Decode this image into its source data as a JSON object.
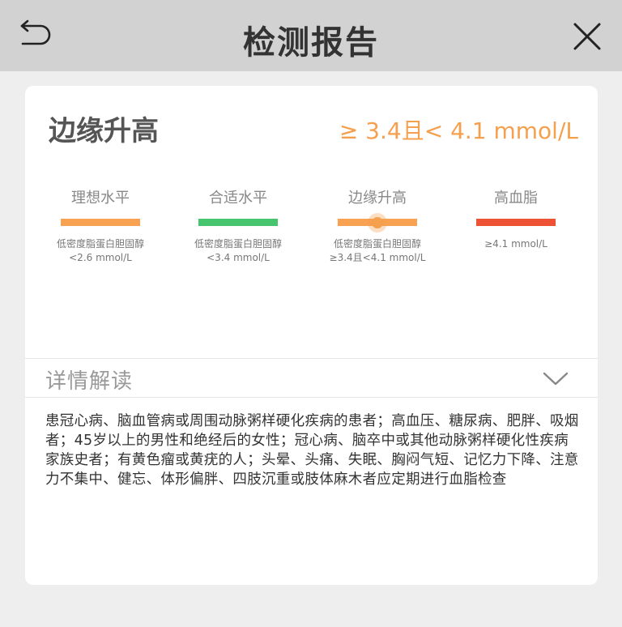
{
  "header": {
    "title": "检测报告",
    "back_icon": "back-arrow-icon",
    "close_icon": "close-icon"
  },
  "result": {
    "level": "边缘升高",
    "range": "≥ 3.4且< 4.1 mmol/L",
    "color": "#f5a04f"
  },
  "scale": [
    {
      "label": "理想水平",
      "color": "#f8a150",
      "desc1": "低密度脂蛋白胆固醇",
      "desc2": "<2.6 mmol/L",
      "current": false
    },
    {
      "label": "合适水平",
      "color": "#46c46e",
      "desc1": "低密度脂蛋白胆固醇",
      "desc2": "<3.4 mmol/L",
      "current": false
    },
    {
      "label": "边缘升高",
      "color": "#f8a150",
      "desc1": "低密度脂蛋白胆固醇",
      "desc2": "≥3.4且<4.1 mmol/L",
      "current": true
    },
    {
      "label": "高血脂",
      "color": "#ee5234",
      "desc1": "≥4.1 mmol/L",
      "desc2": "",
      "current": false
    }
  ],
  "detail": {
    "title": "详情解读",
    "toggle_icon": "chevron-down-icon",
    "text": "患冠心病、脑血管病或周围动脉粥样硬化疾病的患者；高血压、糖尿病、肥胖、吸烟者；45岁以上的男性和绝经后的女性；冠心病、脑卒中或其他动脉粥样硬化性疾病家族史者；有黄色瘤或黄疣的人；头晕、头痛、失眠、胸闷气短、记忆力下降、注意力不集中、健忘、体形偏胖、四肢沉重或肢体麻木者应定期进行血脂检查"
  }
}
